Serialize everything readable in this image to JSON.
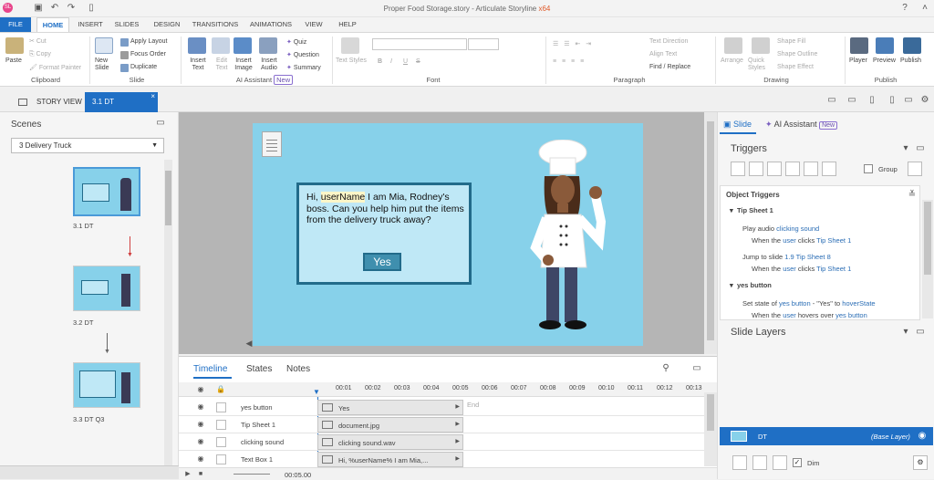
{
  "window": {
    "title": "Proper Food Storage.story - Articulate Storyline",
    "arch": "x64"
  },
  "ribbon_tabs": [
    "FILE",
    "HOME",
    "INSERT",
    "SLIDES",
    "DESIGN",
    "TRANSITIONS",
    "ANIMATIONS",
    "VIEW",
    "HELP"
  ],
  "clipboard": {
    "paste": "Paste",
    "cut": "Cut",
    "copy": "Copy",
    "format_painter": "Format Painter",
    "label": "Clipboard"
  },
  "slide_grp": {
    "new_slide": "New Slide",
    "apply_layout": "Apply Layout",
    "focus_order": "Focus Order",
    "duplicate": "Duplicate",
    "label": "Slide"
  },
  "ai_grp": {
    "insert_text": "Insert Text",
    "edit_text": "Edit Text",
    "insert_image": "Insert Image",
    "insert_audio": "Insert Audio",
    "quiz": "Quiz",
    "question": "Question",
    "summary": "Summary",
    "label": "AI Assistant",
    "badge": "New"
  },
  "font_grp": {
    "text_styles": "Text Styles",
    "label": "Font",
    "bold": "B",
    "italic": "I",
    "underline": "U",
    "strike": "S"
  },
  "para_grp": {
    "text_direction": "Text Direction",
    "align_text": "Align Text",
    "find_replace": "Find / Replace",
    "label": "Paragraph"
  },
  "draw_grp": {
    "arrange": "Arrange",
    "quick_styles": "Quick Styles",
    "shape_fill": "Shape Fill",
    "shape_outline": "Shape Outline",
    "shape_effect": "Shape Effect",
    "label": "Drawing"
  },
  "publish_grp": {
    "player": "Player",
    "preview": "Preview",
    "publish": "Publish",
    "label": "Publish"
  },
  "view_tabs": {
    "story_view": "STORY VIEW",
    "slide_tab": "3.1 DT"
  },
  "scenes": {
    "title": "Scenes",
    "selected": "3 Delivery Truck",
    "thumbs": [
      "3.1 DT",
      "3.2 DT",
      "3.3 DT Q3"
    ]
  },
  "slide": {
    "dialog_pre": "Hi, ",
    "dialog_var": "userName",
    "dialog_post": " I am Mia, Rodney's boss. Can you help him put the items from the delivery truck away?",
    "yes_label": "Yes"
  },
  "timeline": {
    "tabs": [
      "Timeline",
      "States",
      "Notes"
    ],
    "ticks": [
      "00:01",
      "00:02",
      "00:03",
      "00:04",
      "00:05",
      "00:06",
      "00:07",
      "00:08",
      "00:09",
      "00:10",
      "00:11",
      "00:12",
      "00:13"
    ],
    "end_label": "End",
    "rows": [
      {
        "name": "yes button",
        "bar": "Yes"
      },
      {
        "name": "Tip Sheet 1",
        "bar": "document.jpg"
      },
      {
        "name": "clicking sound",
        "bar": "clicking sound.wav"
      },
      {
        "name": "Text Box 1",
        "bar": "Hi, %userName% I am Mia,..."
      }
    ],
    "time": "00:05.00"
  },
  "right": {
    "tabs": {
      "slide": "Slide",
      "ai": "AI Assistant",
      "ai_badge": "New"
    },
    "triggers_title": "Triggers",
    "group_label": "Group",
    "object_triggers": "Object Triggers",
    "items": [
      {
        "type": "header",
        "text": "Tip Sheet 1"
      },
      {
        "type": "action",
        "a": "Play audio ",
        "b": "clicking sound"
      },
      {
        "type": "cond",
        "a": "When the ",
        "b": "user",
        "c": " clicks ",
        "d": "Tip Sheet 1"
      },
      {
        "type": "action",
        "a": "Jump to slide ",
        "b": "1.9 Tip Sheet 8"
      },
      {
        "type": "cond",
        "a": "When the ",
        "b": "user",
        "c": " clicks ",
        "d": "Tip Sheet 1"
      },
      {
        "type": "header",
        "text": "yes button"
      },
      {
        "type": "action",
        "a": "Set state of ",
        "b": "yes button",
        "c": " - \"Yes\" to ",
        "d": "hoverState"
      },
      {
        "type": "cond",
        "a": "When the ",
        "b": "user",
        "c": " hovers over ",
        "d": "yes button"
      }
    ],
    "layers_title": "Slide Layers",
    "base_layer": {
      "name": "DT",
      "tag": "(Base Layer)"
    },
    "dim_label": "Dim"
  },
  "colors": {
    "accent": "#1f6fc5",
    "slide_bg": "#87d1ea",
    "dialog_border": "#226b8a",
    "yes_bg": "#3f8fae"
  }
}
